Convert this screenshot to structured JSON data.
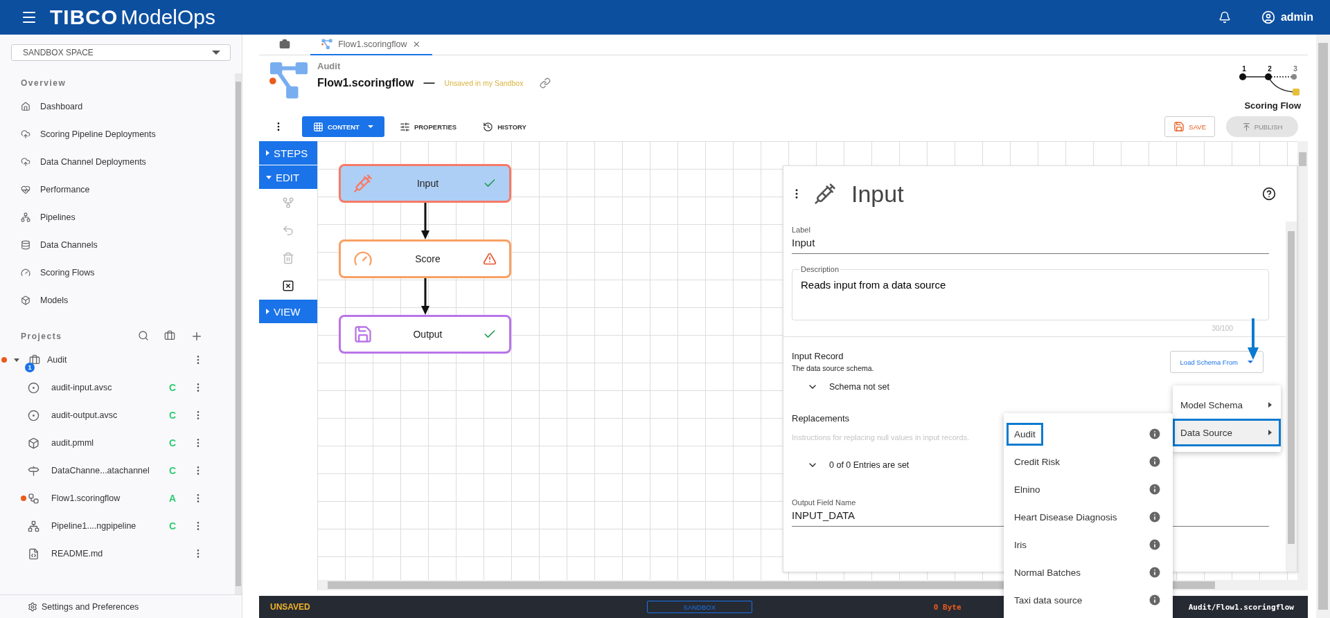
{
  "header": {
    "brand": "TIBCO",
    "product": "ModelOps",
    "user": "admin"
  },
  "sidebar": {
    "space": "SANDBOX SPACE",
    "overview_heading": "Overview",
    "overview": [
      {
        "label": "Dashboard",
        "kind": "home"
      },
      {
        "label": "Scoring Pipeline Deployments",
        "kind": "cloud"
      },
      {
        "label": "Data Channel Deployments",
        "kind": "cloud"
      },
      {
        "label": "Performance",
        "kind": "heart"
      },
      {
        "label": "Pipelines",
        "kind": "pipeline"
      },
      {
        "label": "Data Channels",
        "kind": "database"
      },
      {
        "label": "Scoring Flows",
        "kind": "gauge"
      },
      {
        "label": "Models",
        "kind": "box"
      }
    ],
    "projects_heading": "Projects",
    "projects": [
      {
        "label": "Audit",
        "expanded": true,
        "modified": true,
        "badge": "1",
        "children": [
          {
            "label": "audit-input.avsc",
            "kind": "avro",
            "status": "C",
            "modified": false
          },
          {
            "label": "audit-output.avsc",
            "kind": "avro",
            "status": "C",
            "modified": false
          },
          {
            "label": "audit.pmml",
            "kind": "pmml",
            "status": "C",
            "modified": false
          },
          {
            "label": "DataChanne...atachannel",
            "kind": "channel",
            "status": "C",
            "modified": false
          },
          {
            "label": "Flow1.scoringflow",
            "kind": "flow",
            "status": "A",
            "modified": true
          },
          {
            "label": "Pipeline1....ngpipeline",
            "kind": "pipeline",
            "status": "C",
            "modified": false
          },
          {
            "label": "README.md",
            "kind": "readme",
            "modified": false
          }
        ]
      }
    ],
    "footer": "Settings and Preferences"
  },
  "tabs": [
    {
      "kind": "home",
      "selected": false
    },
    {
      "kind": "flow",
      "label": "Flow1.scoringflow",
      "selected": true,
      "modified": true
    }
  ],
  "artifact": {
    "project": "Audit",
    "name": "Flow1.scoringflow",
    "separator": "—",
    "state": "Unsaved in my Sandbox"
  },
  "stepper": {
    "title": "Scoring Flow",
    "steps": [
      {
        "label": "1",
        "done": true
      },
      {
        "label": "2",
        "done": true
      },
      {
        "label": "3",
        "done": false
      }
    ]
  },
  "toolbar": {
    "tabs": [
      {
        "label": "CONTENT",
        "kind": "grid",
        "selected": true
      },
      {
        "label": "PROPERTIES",
        "kind": "sliders",
        "selected": false
      },
      {
        "label": "HISTORY",
        "kind": "history",
        "selected": false
      }
    ],
    "save": "SAVE",
    "publish": {
      "label": "PUBLISH",
      "disabled": true
    }
  },
  "side_panel": {
    "sections": [
      {
        "label": "STEPS",
        "expanded": false
      },
      {
        "label": "EDIT",
        "expanded": true
      },
      {
        "label": "VIEW",
        "expanded": false
      }
    ],
    "tools": [
      {
        "kind": "layout",
        "disabled": true
      },
      {
        "kind": "undo",
        "disabled": true
      },
      {
        "kind": "delete",
        "disabled": true
      },
      {
        "kind": "clear",
        "disabled": false
      }
    ]
  },
  "nodes": [
    {
      "label": "Input",
      "kind": "input",
      "valid": true,
      "selected": true
    },
    {
      "label": "Score",
      "kind": "score",
      "valid": false,
      "selected": false
    },
    {
      "label": "Output",
      "kind": "output",
      "valid": true,
      "selected": false
    }
  ],
  "properties": {
    "title": "Input",
    "label_field": {
      "label": "Label",
      "value": "Input"
    },
    "description": {
      "label": "Description",
      "value": "Reads input from a data source",
      "counter": "30/100"
    },
    "input_record": {
      "title": "Input Record",
      "subtitle": "The data source schema.",
      "schema": "Schema not set",
      "load_button": "Load Schema From"
    },
    "replacements": {
      "title": "Replacements",
      "subtitle": "Instructions for replacing null values in input records.",
      "entries": "0 of 0 Entries are set"
    },
    "output_field": {
      "label": "Output Field Name",
      "value": "INPUT_DATA"
    }
  },
  "schema_menu": [
    {
      "label": "Model Schema",
      "selected": false
    },
    {
      "label": "Data Source",
      "selected": true
    }
  ],
  "data_sources": [
    {
      "label": "Audit",
      "selected": true
    },
    {
      "label": "Credit Risk",
      "selected": false
    },
    {
      "label": "Elnino",
      "selected": false
    },
    {
      "label": "Heart Disease Diagnosis",
      "selected": false
    },
    {
      "label": "Iris",
      "selected": false
    },
    {
      "label": "Normal Batches",
      "selected": false
    },
    {
      "label": "Taxi data source",
      "selected": false
    }
  ],
  "status_bar": {
    "state": "UNSAVED",
    "space": "SANDBOX",
    "size": "0 Byte",
    "path": "Audit/Flow1.scoringflow"
  }
}
